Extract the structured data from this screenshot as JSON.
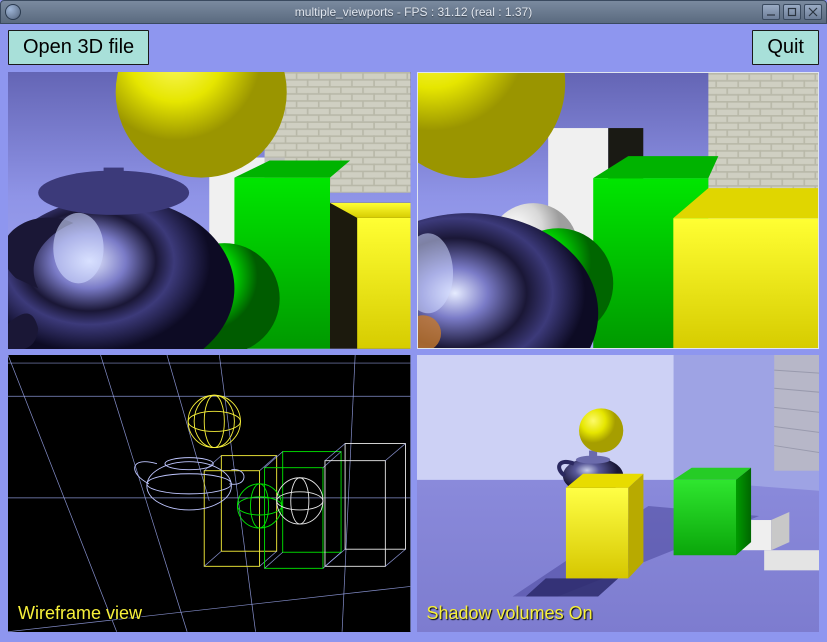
{
  "titlebar": {
    "title": "multiple_viewports - FPS : 31.12 (real : 1.37)"
  },
  "toolbar": {
    "open_label": "Open 3D file",
    "quit_label": "Quit"
  },
  "viewports": {
    "wireframe_label": "Wireframe view",
    "shadow_label": "Shadow volumes On"
  },
  "caption_colors": {
    "wireframe": "#f7f03a",
    "shadow": "#f7f03a"
  }
}
